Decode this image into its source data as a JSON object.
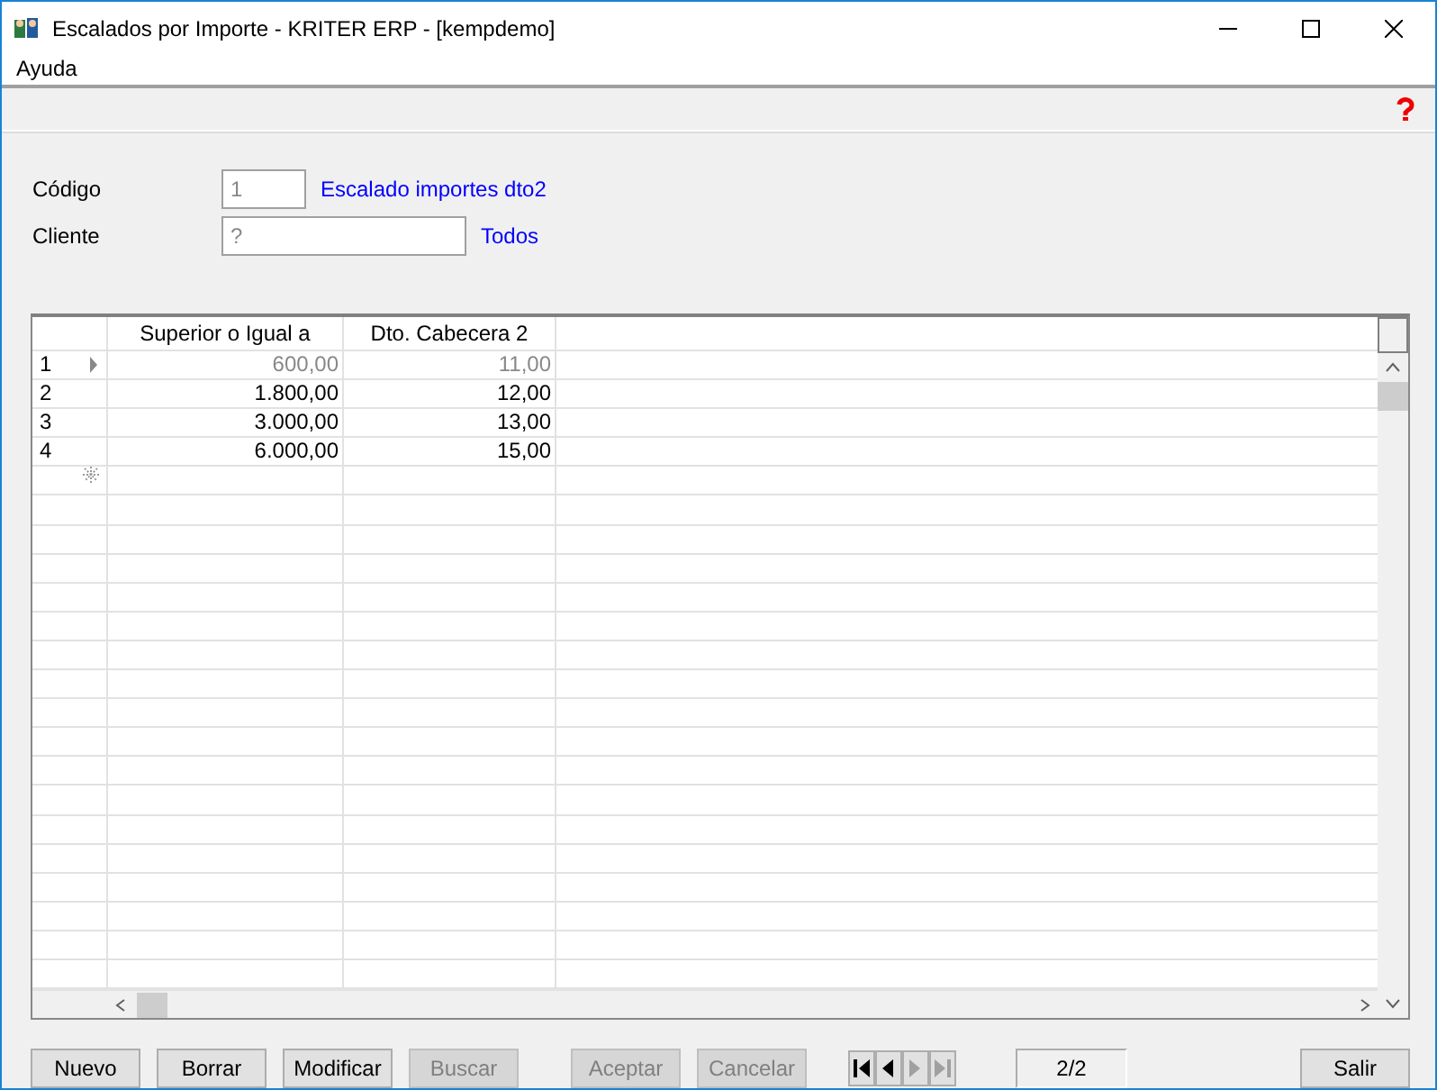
{
  "window": {
    "title": "Escalados por Importe - KRITER ERP - [kempdemo]"
  },
  "menu": [
    "Ayuda"
  ],
  "form": {
    "fields": [
      {
        "label": "Código",
        "value": "1",
        "link": "Escalado importes dto2",
        "wide": false
      },
      {
        "label": "Cliente",
        "value": "?",
        "link": "Todos",
        "wide": true
      }
    ]
  },
  "grid": {
    "columns": [
      "Superior o Igual a",
      "Dto. Cabecera 2"
    ],
    "rows": [
      {
        "number": "1",
        "cells": [
          "600,00",
          "11,00"
        ],
        "selected": true
      },
      {
        "number": "2",
        "cells": [
          "1.800,00",
          "12,00"
        ],
        "selected": false
      },
      {
        "number": "3",
        "cells": [
          "3.000,00",
          "13,00"
        ],
        "selected": false
      },
      {
        "number": "4",
        "cells": [
          "6.000,00",
          "15,00"
        ],
        "selected": false
      }
    ]
  },
  "buttons": [
    {
      "label": "Nuevo",
      "disabled": false
    },
    {
      "label": "Borrar",
      "disabled": false
    },
    {
      "label": "Modificar",
      "disabled": false
    },
    {
      "label": "Buscar",
      "disabled": true
    }
  ],
  "confirm_buttons": [
    {
      "label": "Aceptar",
      "disabled": true
    },
    {
      "label": "Cancelar",
      "disabled": true
    }
  ],
  "navigator": {
    "position": "2/2"
  },
  "exit_button": {
    "label": "Salir",
    "disabled": false
  }
}
